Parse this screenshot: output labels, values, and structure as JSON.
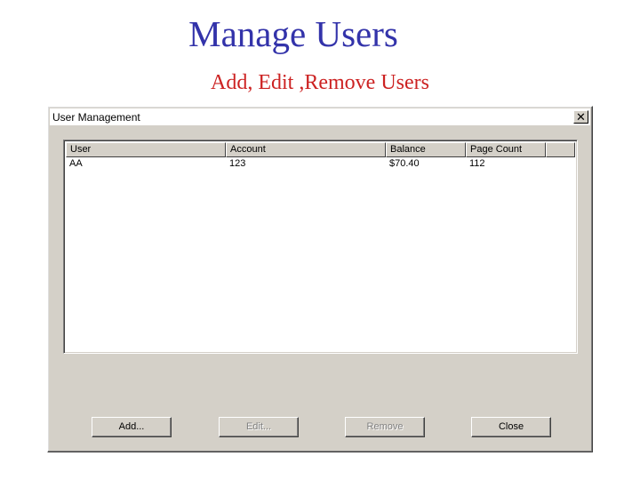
{
  "slide": {
    "title": "Manage Users",
    "subtitle": "Add, Edit ,Remove Users"
  },
  "window": {
    "title": "User Management",
    "close_glyph": "✕"
  },
  "table": {
    "columns": [
      "User",
      "Account",
      "Balance",
      "Page Count"
    ],
    "rows": [
      [
        "AA",
        "123",
        "$70.40",
        "112"
      ]
    ]
  },
  "buttons": {
    "add": "Add...",
    "edit": "Edit...",
    "remove": "Remove",
    "close": "Close"
  }
}
